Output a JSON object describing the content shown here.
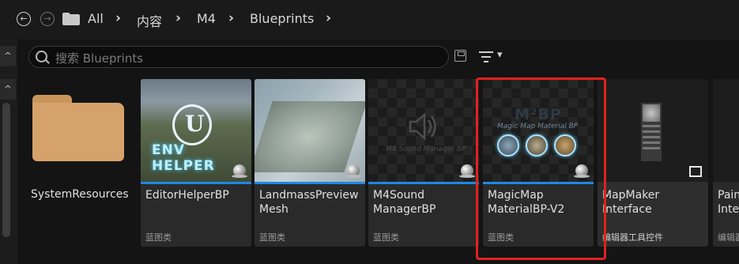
{
  "breadcrumb": {
    "items": [
      "All",
      "内容",
      "M4",
      "Blueprints"
    ]
  },
  "search": {
    "placeholder": "搜索 Blueprints"
  },
  "folder": {
    "label": "SystemResources"
  },
  "assets": [
    {
      "name": "EditorHelperBP",
      "type": "蓝图类",
      "thumb_text": "ENV HELPER"
    },
    {
      "name": "LandmassPreviewMesh",
      "type": "蓝图类",
      "thumb_text": ""
    },
    {
      "name": "M4SoundManagerBP",
      "type": "蓝图类",
      "thumb_text": "M4 Sound Manager BP"
    },
    {
      "name": "MagicMapMaterialBP-V2",
      "type": "蓝图类",
      "thumb_text": "Magic Map Material BP",
      "thumb_title": "M²BP"
    },
    {
      "name": "MapMakerInterface",
      "type": "编辑器工具控件",
      "thumb_text": ""
    },
    {
      "name": "PaintInterface",
      "type": "编辑器"
    }
  ],
  "labels": {
    "c1_line1": "EditorHelperBP",
    "c2_line1": "LandmassPreview",
    "c2_line2": "Mesh",
    "c3_line1": "M4Sound",
    "c3_line2": "ManagerBP",
    "c4_line1": "MagicMap",
    "c4_line2": "MaterialBP-V2",
    "c5_line1": "MapMaker",
    "c5_line2": "Interface",
    "c6_line1": "Pain",
    "c6_line2": "Inter"
  },
  "colors": {
    "selection_highlight": "#e22020",
    "blueprint_bar": "#1e88e5",
    "folder": "#d4a26a"
  }
}
